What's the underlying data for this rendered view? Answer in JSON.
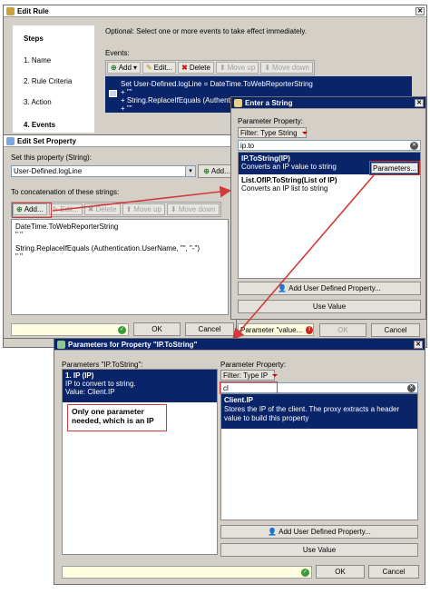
{
  "edit_rule": {
    "title": "Edit Rule",
    "steps_heading": "Steps",
    "steps": [
      "1. Name",
      "2. Rule Criteria",
      "3. Action",
      "4. Events"
    ],
    "instruction": "Optional: Select one or more events to take effect immediately.",
    "events_label": "Events:",
    "toolbar": {
      "add": "Add",
      "edit": "Edit...",
      "delete": "Delete",
      "move_up": "Move up",
      "move_down": "Move down"
    },
    "events_lines": [
      "Set User-Defined.logLine = DateTime.ToWebReporterString",
      "+ \"\"",
      "+ String.ReplaceIfEquals (Authentic",
      "+ \"\""
    ],
    "bottom_text": "Parameter \"value...",
    "ok": "OK",
    "cancel": "Cancel"
  },
  "edit_set": {
    "title": "Edit Set Property",
    "set_label": "Set this property (String):",
    "property_value": "User-Defined.logLine",
    "add_short": "Add...",
    "concat_label": "To concatenation of these strings:",
    "toolbar": {
      "add": "Add...",
      "edit": "Edit...",
      "delete": "Delete",
      "move_up": "Move up",
      "move_down": "Move down"
    },
    "lines": [
      "DateTime.ToWebReporterString",
      "\" \"",
      "String.ReplaceIfEquals (Authentication.UserName, \"\", \"-\")",
      "\" \""
    ],
    "ok": "OK",
    "cancel": "Cancel"
  },
  "enter_string": {
    "title": "Enter a String",
    "param_label": "Parameter Property:",
    "filter": "Filter: Type String",
    "search": "ip.to",
    "items": [
      {
        "name": "IP.ToString(IP)",
        "desc": "Converts an IP value to string"
      },
      {
        "name": "List.OfIP.ToString(List of IP)",
        "desc": "Converts an IP list to string"
      }
    ],
    "parameters_button": "Parameters...",
    "add_udp": "Add User Defined Property...",
    "use_value": "Use Value"
  },
  "params_dialog": {
    "title": "Parameters for Property \"IP.ToString\"",
    "left_label": "Parameters \"IP.ToString\":",
    "param_name": "1. IP (IP)",
    "param_desc": "IP to convert to string.",
    "param_value": "Value: Client.IP",
    "callout": "Only one parameter needed, which is an IP",
    "right_label": "Parameter Property:",
    "filter": "Filter: Type IP",
    "search": "cl",
    "item_name": "Client.IP",
    "item_desc": "Stores the IP of the client. The proxy extracts a header value to build this property",
    "add_udp": "Add User Defined Property...",
    "use_value": "Use Value",
    "ok": "OK",
    "cancel": "Cancel"
  },
  "colors": {
    "selection": "#0a246a",
    "callout_border": "#d23a3a",
    "arrow": "#d23a3a",
    "dialog_bg": "#d4d0c8"
  }
}
